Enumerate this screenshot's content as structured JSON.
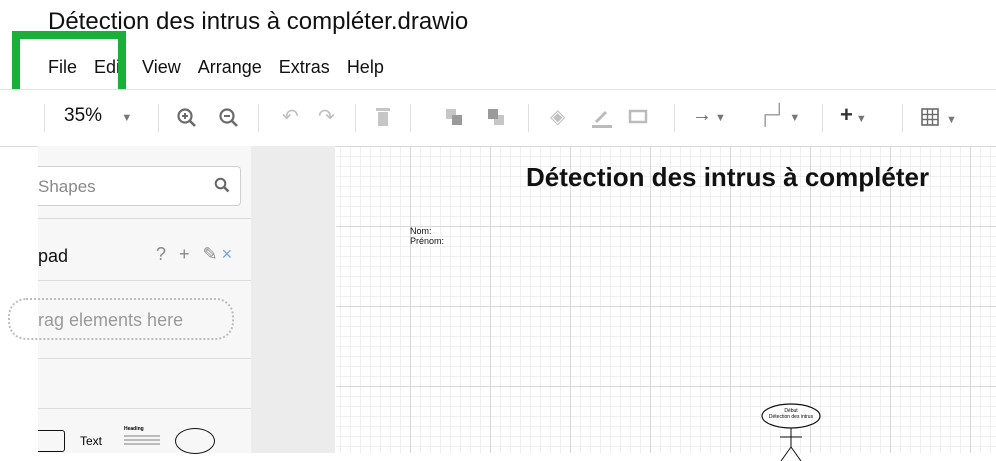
{
  "window": {
    "title": "Détection des intrus à compléter.drawio"
  },
  "menu": [
    "File",
    "Edit",
    "View",
    "Arrange",
    "Extras",
    "Help"
  ],
  "toolbar": {
    "zoom": "35%"
  },
  "sidebar": {
    "search_placeholder": "Shapes",
    "scratchpad_label": "pad",
    "scratchpad_actions": "? + ✎",
    "scratchpad_close": "×",
    "drop_hint": "rag elements here",
    "shape_text_label": "Text",
    "shape_heading_label": "Heading"
  },
  "canvas": {
    "title": "Détection des intrus à compléter",
    "nom": "Nom:",
    "prenom": "Prénom:",
    "node_line1": "Début",
    "node_line2": "Détection des intrus"
  },
  "colors": {
    "highlight": "#19b03a",
    "accent": "#7ba3d6"
  }
}
